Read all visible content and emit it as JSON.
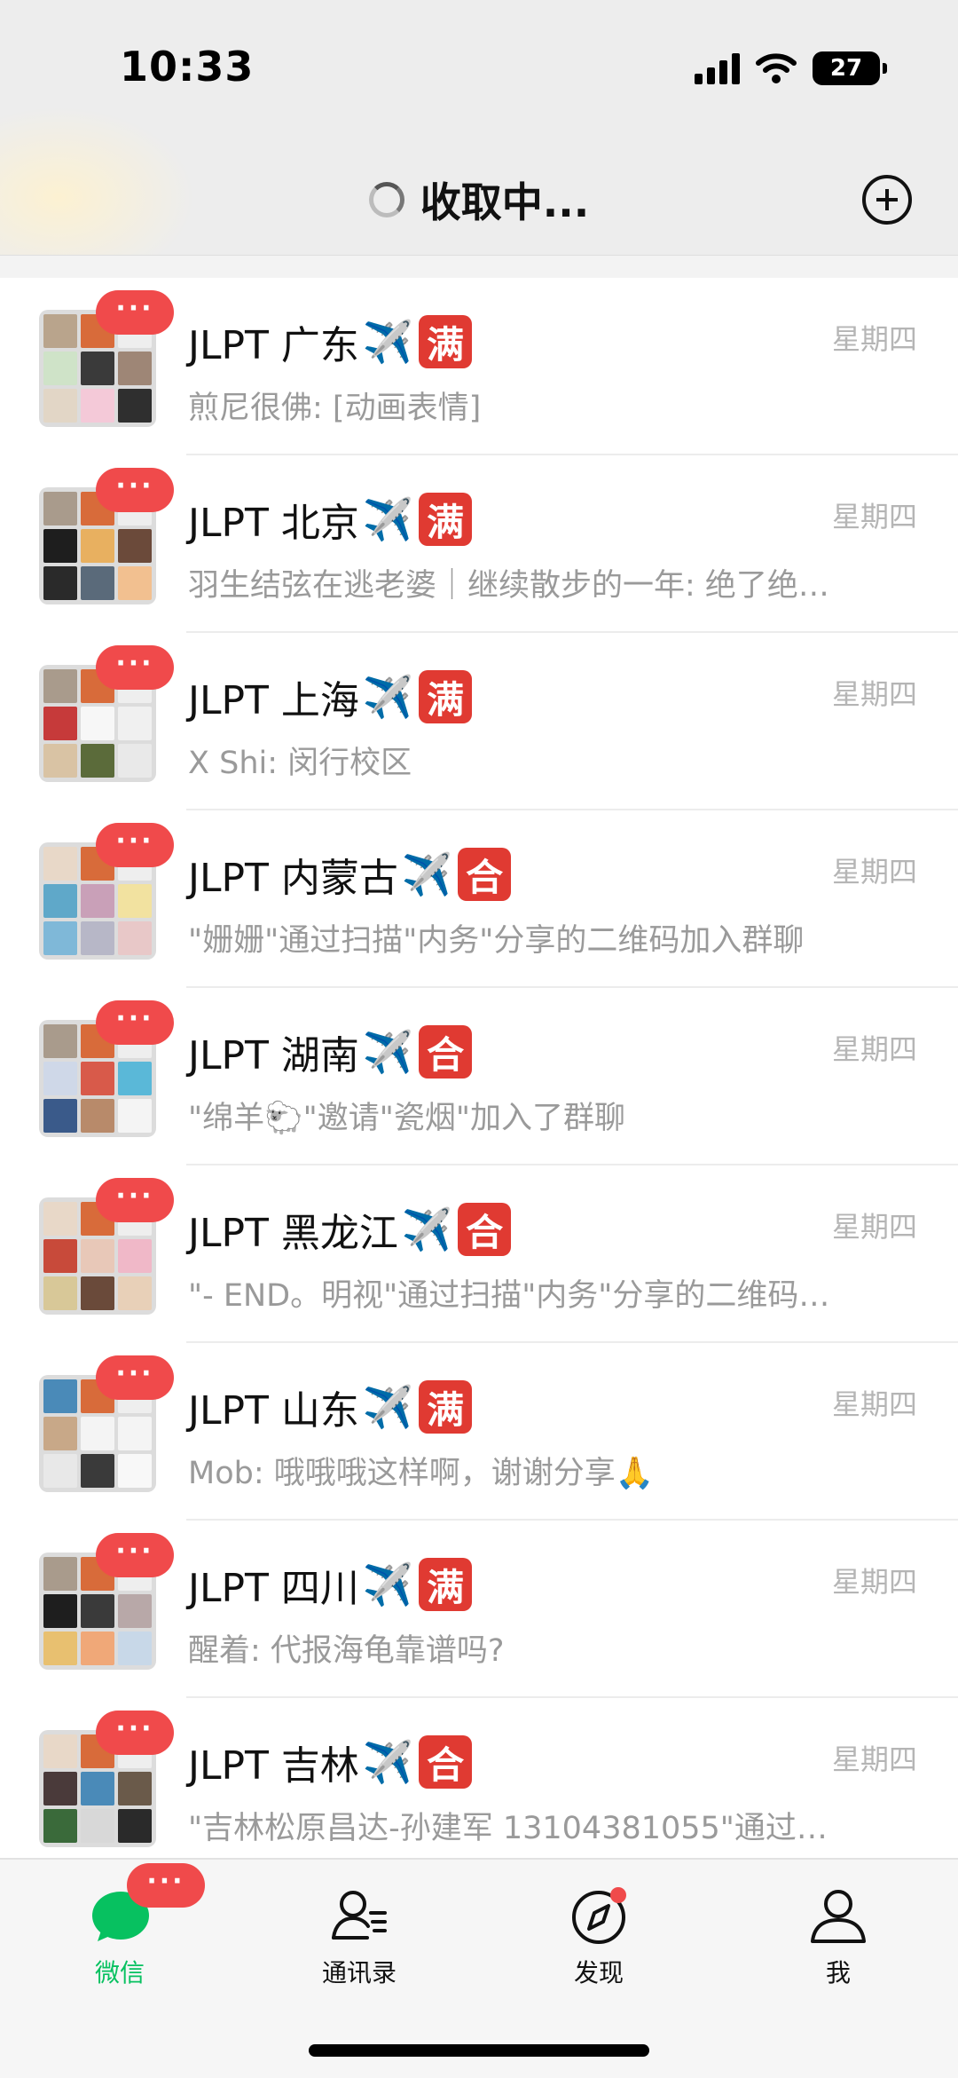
{
  "status_bar": {
    "time": "10:33",
    "battery": "27"
  },
  "header": {
    "title": "收取中..."
  },
  "chats": [
    {
      "name": "JLPT 广东",
      "tag": "满",
      "time": "星期四",
      "preview": "煎尼很佛: [动画表情]"
    },
    {
      "name": "JLPT 北京",
      "tag": "满",
      "time": "星期四",
      "preview": "羽生结弦在逃老婆｜继续散步的一年: 绝了绝…"
    },
    {
      "name": "JLPT 上海",
      "tag": "满",
      "time": "星期四",
      "preview": "X Shi: 闵行校区"
    },
    {
      "name": "JLPT 内蒙古",
      "tag": "合",
      "time": "星期四",
      "preview": "\"姗姗\"通过扫描\"内务\"分享的二维码加入群聊"
    },
    {
      "name": "JLPT 湖南",
      "tag": "合",
      "time": "星期四",
      "preview": "\"绵羊🐑\"邀请\"瓷烟\"加入了群聊"
    },
    {
      "name": "JLPT 黑龙江",
      "tag": "合",
      "time": "星期四",
      "preview": "\"- END。明视\"通过扫描\"内务\"分享的二维码…"
    },
    {
      "name": "JLPT 山东",
      "tag": "满",
      "time": "星期四",
      "preview": "Mob: 哦哦哦这样啊，谢谢分享🙏"
    },
    {
      "name": "JLPT 四川",
      "tag": "满",
      "time": "星期四",
      "preview": "醒着: 代报海龟靠谱吗?"
    },
    {
      "name": "JLPT 吉林",
      "tag": "合",
      "time": "星期四",
      "preview": "\"吉林松原昌达-孙建军 13104381055\"通过…"
    }
  ],
  "badge": "···",
  "plane_emoji": "✈️",
  "tabs": [
    {
      "label": "微信",
      "icon": "chat-bubble-icon",
      "active": true
    },
    {
      "label": "通讯录",
      "icon": "contacts-icon",
      "active": false
    },
    {
      "label": "发现",
      "icon": "compass-icon",
      "active": false
    },
    {
      "label": "我",
      "icon": "person-icon",
      "active": false
    }
  ],
  "colors": {
    "accent_green": "#07c160",
    "badge_red": "#f04a4b",
    "tag_red": "#e03a32"
  }
}
